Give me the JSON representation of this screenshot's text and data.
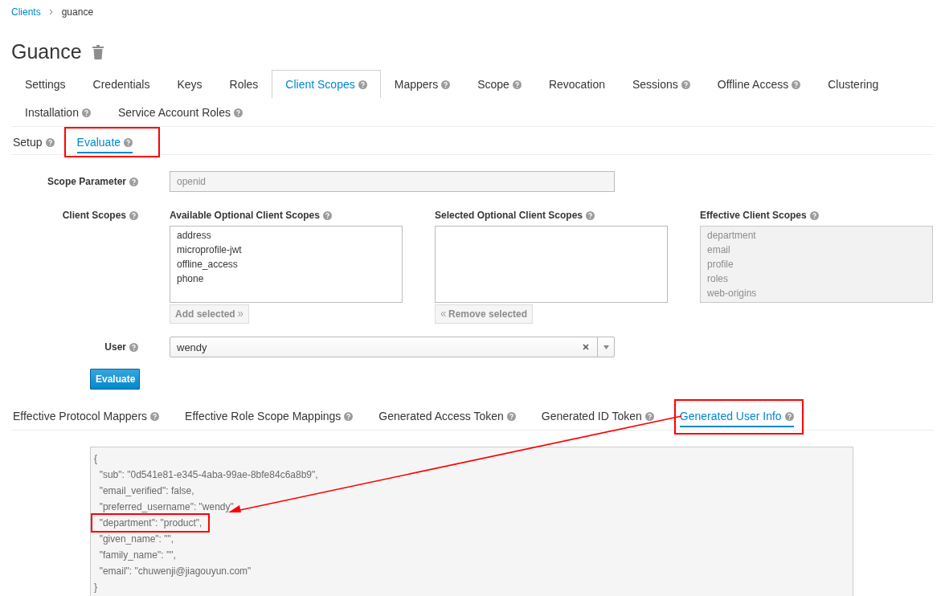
{
  "breadcrumb": [
    {
      "label": "Clients",
      "link": true
    },
    {
      "label": "guance",
      "link": false
    }
  ],
  "title": "Guance",
  "tabs": [
    {
      "label": "Settings",
      "help": false,
      "selected": false
    },
    {
      "label": "Credentials",
      "help": false,
      "selected": false
    },
    {
      "label": "Keys",
      "help": false,
      "selected": false
    },
    {
      "label": "Roles",
      "help": false,
      "selected": false
    },
    {
      "label": "Client Scopes",
      "help": true,
      "selected": true
    },
    {
      "label": "Mappers",
      "help": true,
      "selected": false
    },
    {
      "label": "Scope",
      "help": true,
      "selected": false
    },
    {
      "label": "Revocation",
      "help": false,
      "selected": false
    },
    {
      "label": "Sessions",
      "help": true,
      "selected": false
    },
    {
      "label": "Offline Access",
      "help": true,
      "selected": false
    },
    {
      "label": "Clustering",
      "help": false,
      "selected": false
    },
    {
      "label": "Installation",
      "help": true,
      "selected": false
    },
    {
      "label": "Service Account Roles",
      "help": true,
      "selected": false
    }
  ],
  "subtabs": [
    {
      "label": "Setup",
      "selected": false,
      "annotated": false
    },
    {
      "label": "Evaluate",
      "selected": true,
      "annotated": true
    }
  ],
  "form": {
    "scope_parameter": {
      "label": "Scope Parameter",
      "value": "openid"
    },
    "client_scopes": {
      "label": "Client Scopes",
      "lists": [
        {
          "title": "Available Optional Client Scopes",
          "items": [
            "address",
            "microprofile-jwt",
            "offline_access",
            "phone"
          ],
          "disabled": false,
          "button": "Add selected",
          "kind": "add"
        },
        {
          "title": "Selected Optional Client Scopes",
          "disabled": false,
          "button": "Remove selected",
          "kind": "remove"
        },
        {
          "title": "Effective Client Scopes",
          "items": [
            "department",
            "email",
            "profile",
            "roles",
            "web-origins"
          ],
          "disabled": true
        }
      ]
    },
    "user": {
      "label": "User",
      "value": "wendy"
    },
    "evaluate_button": "Evaluate"
  },
  "result_tabs": [
    {
      "label": "Effective Protocol Mappers",
      "selected": false,
      "annotated": false
    },
    {
      "label": "Effective Role Scope Mappings",
      "selected": false,
      "annotated": false
    },
    {
      "label": "Generated Access Token",
      "selected": false,
      "annotated": false
    },
    {
      "label": "Generated ID Token",
      "selected": false,
      "annotated": false
    },
    {
      "label": "Generated User Info",
      "selected": true,
      "annotated": true
    }
  ],
  "output": [
    {
      "text": "{",
      "annotated": false
    },
    {
      "text": "  \"sub\": \"0d541e81-e345-4aba-99ae-8bfe84c6a8b9\",",
      "annotated": false
    },
    {
      "text": "  \"email_verified\": false,",
      "annotated": false
    },
    {
      "text": "  \"preferred_username\": \"wendy\",",
      "annotated": false
    },
    {
      "text": "  \"department\": \"product\",",
      "annotated": true
    },
    {
      "text": "  \"given_name\": \"\",",
      "annotated": false
    },
    {
      "text": "  \"family_name\": \"\",",
      "annotated": false
    },
    {
      "text": "  \"email\": \"chuwenji@jiagouyun.com\"",
      "annotated": false
    },
    {
      "text": "}",
      "annotated": false
    }
  ],
  "annotation_arrow": true
}
